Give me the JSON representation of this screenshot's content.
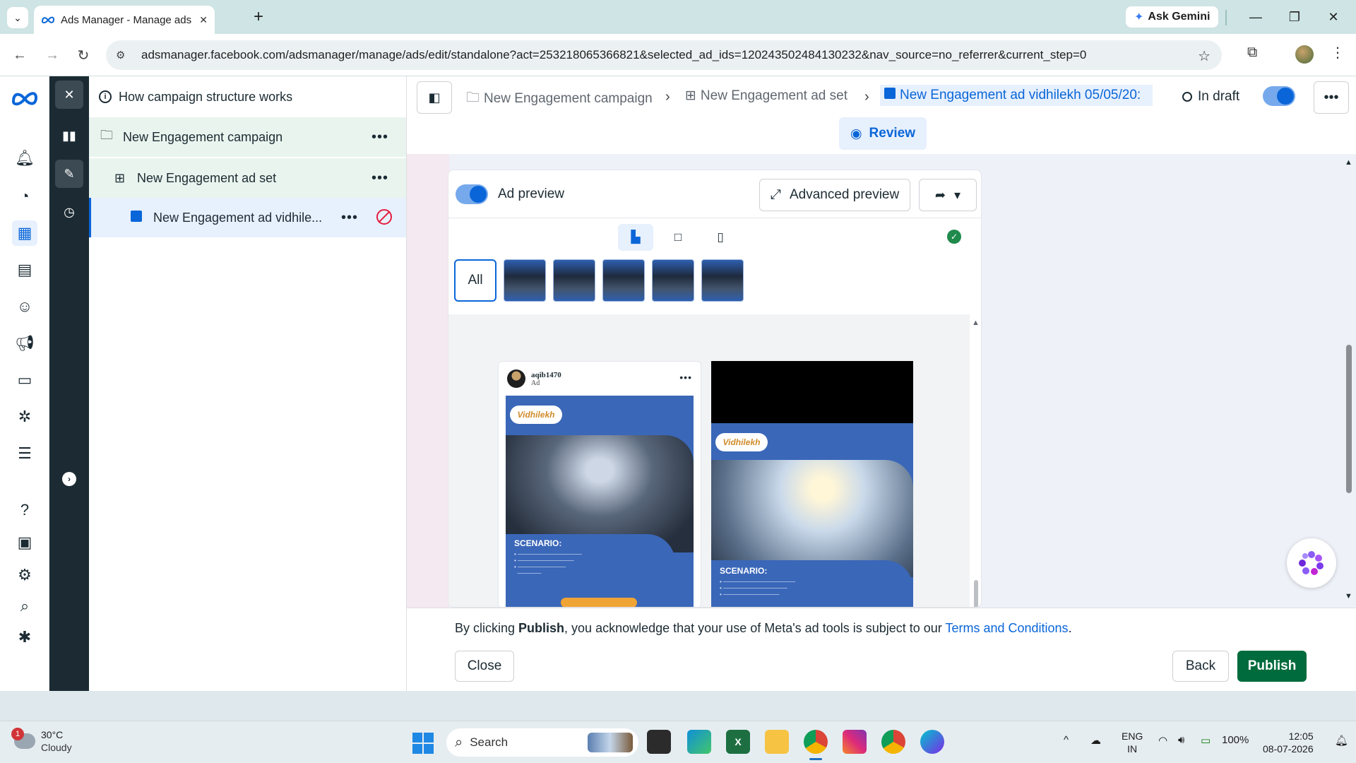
{
  "browser": {
    "tab_title": "Ads Manager - Manage ads - A",
    "gemini_label": "Ask Gemini",
    "url": "adsmanager.facebook.com/adsmanager/manage/ads/edit/standalone?act=253218065366821&selected_ad_ids=120243502484130232&nav_source=no_referrer&current_step=0"
  },
  "tree": {
    "header": "How campaign structure works",
    "campaign": "New Engagement campaign",
    "adset": "New Engagement ad set",
    "ad": "New Engagement ad vidhile..."
  },
  "breadcrumb": {
    "campaign": "New Engagement campaign",
    "adset": "New Engagement ad set",
    "ad": "New Engagement ad vidhilekh 05/05/20:"
  },
  "status": "In draft",
  "review_label": "Review",
  "preview": {
    "toggle_label": "Ad preview",
    "advanced_label": "Advanced preview",
    "all_label": "All",
    "feed_user": "aqib1470",
    "feed_sub": "Ad",
    "brand": "Vidhilekh",
    "scenario_title": "SCENARIO:"
  },
  "footer": {
    "legal_prefix": "By clicking ",
    "legal_bold": "Publish",
    "legal_middle": ", you acknowledge that your use of Meta's ad tools is subject to our ",
    "legal_link": "Terms and Conditions",
    "legal_end": ".",
    "close_label": "Close",
    "back_label": "Back",
    "publish_label": "Publish"
  },
  "taskbar": {
    "temp": "30°C",
    "condition": "Cloudy",
    "notif_count": "1",
    "search_label": "Search",
    "lang_top": "ENG",
    "lang_bottom": "IN",
    "battery": "100%",
    "time": "12:05",
    "date": "08-07-2026"
  },
  "colors": {
    "accent": "#0a66d8",
    "publish": "#006b3c",
    "dark_rail": "#1c2b33"
  }
}
